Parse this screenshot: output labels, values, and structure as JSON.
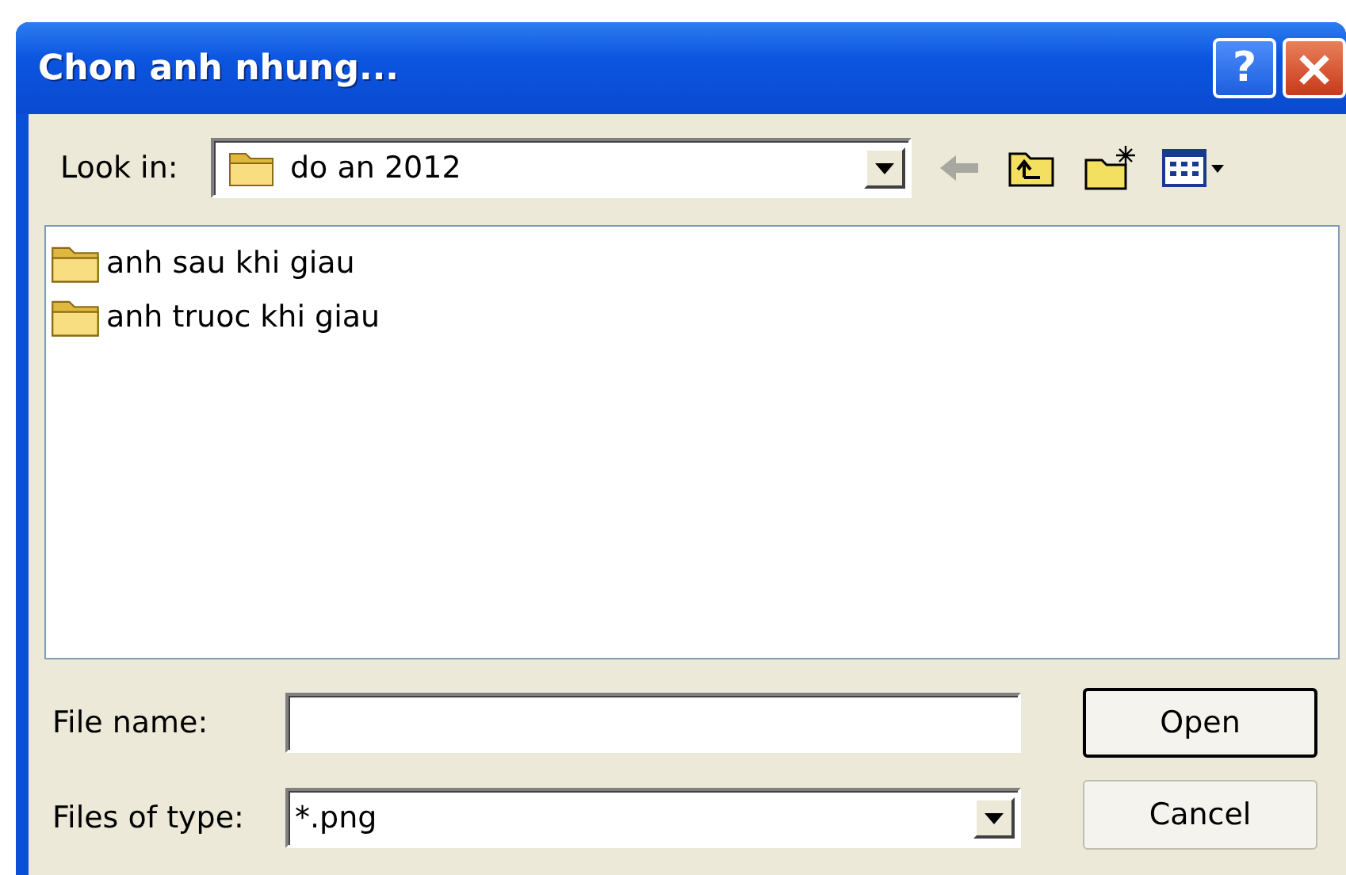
{
  "window": {
    "title": "Chon anh nhung..."
  },
  "title_buttons": [
    {
      "kind": "help",
      "label": "?"
    },
    {
      "kind": "close"
    }
  ],
  "look_in": {
    "label": "Look in:",
    "value": "do an 2012"
  },
  "toolbar": [
    {
      "kind": "back",
      "disabled": true
    },
    {
      "kind": "up",
      "disabled": false
    },
    {
      "kind": "new-folder",
      "disabled": false
    },
    {
      "kind": "view",
      "disabled": false
    }
  ],
  "files": [
    {
      "name": "anh sau khi giau",
      "selected": false
    },
    {
      "name": "anh truoc khi giau",
      "selected": false
    }
  ],
  "file_name": {
    "label": "File name:"
  },
  "file_type": {
    "label": "Files of type:",
    "value": "*.png"
  },
  "buttons": [
    {
      "label": "Open",
      "default": true
    },
    {
      "label": "Cancel",
      "default": false
    }
  ]
}
